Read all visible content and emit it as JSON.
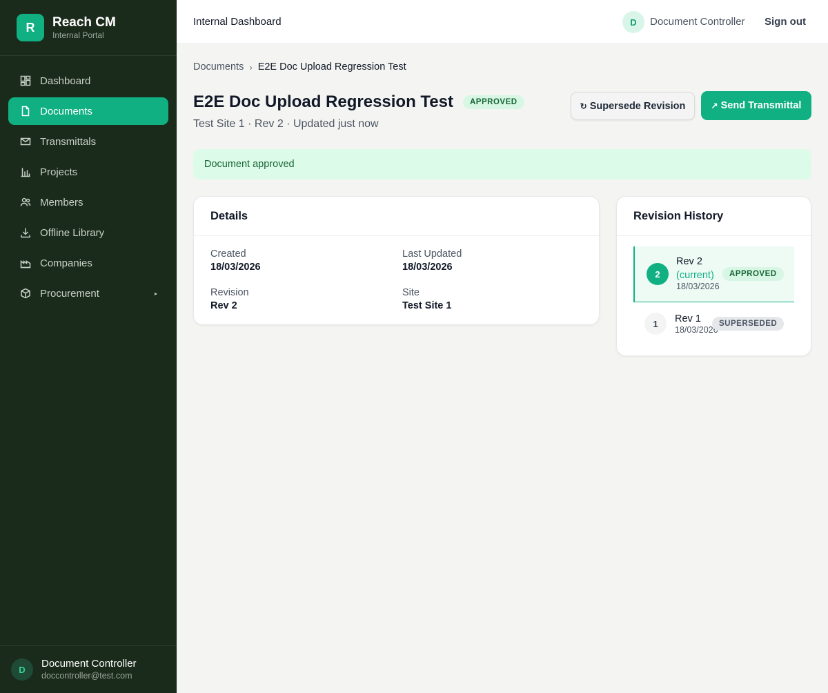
{
  "brand": {
    "logo_letter": "R",
    "name": "Reach CM",
    "subtitle": "Internal Portal"
  },
  "sidebar": {
    "items": [
      {
        "label": "Dashboard",
        "icon": "dashboard-icon",
        "active": false
      },
      {
        "label": "Documents",
        "icon": "document-icon",
        "active": true
      },
      {
        "label": "Transmittals",
        "icon": "mail-icon",
        "active": false
      },
      {
        "label": "Projects",
        "icon": "bar-chart-icon",
        "active": false
      },
      {
        "label": "Members",
        "icon": "users-icon",
        "active": false
      },
      {
        "label": "Offline Library",
        "icon": "download-icon",
        "active": false
      },
      {
        "label": "Companies",
        "icon": "factory-icon",
        "active": false
      },
      {
        "label": "Procurement",
        "icon": "box-icon",
        "active": false,
        "caret": "▸"
      }
    ],
    "user": {
      "initial": "D",
      "name": "Document Controller",
      "email": "doccontroller@test.com"
    }
  },
  "topbar": {
    "title": "Internal Dashboard",
    "user_initial": "D",
    "user_name": "Document Controller",
    "signout_label": "Sign out"
  },
  "breadcrumb": {
    "parent": "Documents",
    "separator": "›",
    "current": "E2E Doc Upload Regression Test"
  },
  "document": {
    "title": "E2E Doc Upload Regression Test",
    "status": "APPROVED",
    "subtitle": "Test Site 1 · Rev 2 · Updated just now"
  },
  "actions": {
    "supersede_icon": "↻",
    "supersede_label": "Supersede Revision",
    "transmittal_icon": "↗",
    "transmittal_label": "Send Transmittal"
  },
  "alert": {
    "message": "Document approved"
  },
  "details": {
    "heading": "Details",
    "fields": [
      {
        "label": "Created",
        "value": "18/03/2026"
      },
      {
        "label": "Last Updated",
        "value": "18/03/2026"
      },
      {
        "label": "Revision",
        "value": "Rev 2"
      },
      {
        "label": "Site",
        "value": "Test Site 1"
      }
    ]
  },
  "revision_history": {
    "heading": "Revision History",
    "revisions": [
      {
        "number": "2",
        "name": "Rev 2",
        "tag": "(current)",
        "date": "18/03/2026",
        "status": "APPROVED"
      },
      {
        "number": "1",
        "name": "Rev 1",
        "date": "18/03/2026",
        "status": "SUPERSEDED"
      }
    ]
  },
  "colors": {
    "accent": "#10b083",
    "sidebar_bg": "#1b2b1b",
    "approved_bg": "#d7f7e4",
    "alert_bg": "#dcfbe8"
  }
}
